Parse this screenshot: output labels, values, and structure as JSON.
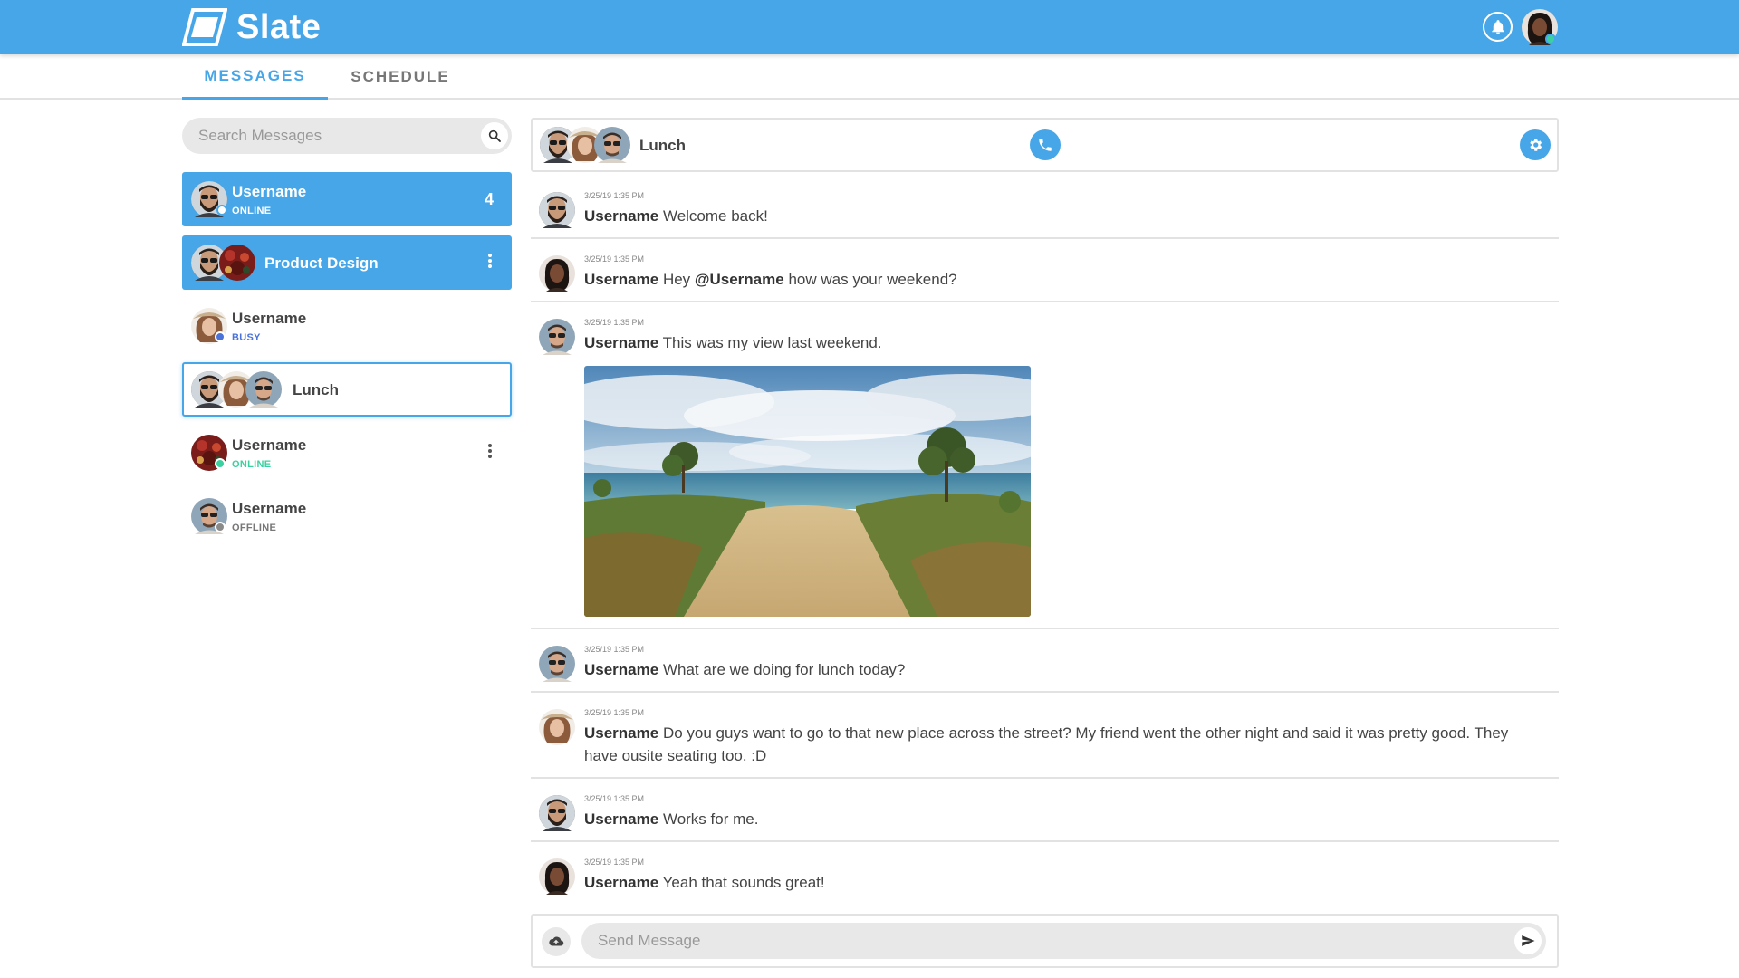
{
  "app": {
    "name": "Slate"
  },
  "colors": {
    "primary": "#46a6e8",
    "online": "#3cd0a0",
    "busy": "#4a72d8",
    "offline": "#8a8a8a"
  },
  "header": {
    "icons": [
      "bell-icon",
      "avatar"
    ]
  },
  "tabs": [
    {
      "label": "MESSAGES",
      "active": true
    },
    {
      "label": "SCHEDULE",
      "active": false
    }
  ],
  "search": {
    "placeholder": "Search Messages"
  },
  "conversations": [
    {
      "name": "Username",
      "status": "ONLINE",
      "unread": "4"
    },
    {
      "name": "Product Design"
    },
    {
      "name": "Username",
      "status": "BUSY"
    },
    {
      "name": "Lunch"
    },
    {
      "name": "Username",
      "status": "ONLINE"
    },
    {
      "name": "Username",
      "status": "OFFLINE"
    }
  ],
  "chat": {
    "title": "Lunch",
    "messages": [
      {
        "time": "3/25/19 1:35 PM",
        "user": "Username",
        "text": "Welcome back!"
      },
      {
        "time": "3/25/19 1:35 PM",
        "user": "Username",
        "text_before": "Hey",
        "mention": "@Username",
        "text_after": "how was your weekend?"
      },
      {
        "time": "3/25/19 1:35 PM",
        "user": "Username",
        "text": "This was my view last weekend."
      },
      {
        "time": "3/25/19 1:35 PM",
        "user": "Username",
        "text": "What are we doing for lunch today?"
      },
      {
        "time": "3/25/19 1:35 PM",
        "user": "Username",
        "text": "Do you guys want to go to that new place across the street? My friend went the other night and said it was pretty good. They have ousite seating too. :D"
      },
      {
        "time": "3/25/19 1:35 PM",
        "user": "Username",
        "text": "Works for me."
      },
      {
        "time": "3/25/19 1:35 PM",
        "user": "Username",
        "text": "Yeah that sounds great!"
      }
    ]
  },
  "composer": {
    "placeholder": "Send Message"
  }
}
